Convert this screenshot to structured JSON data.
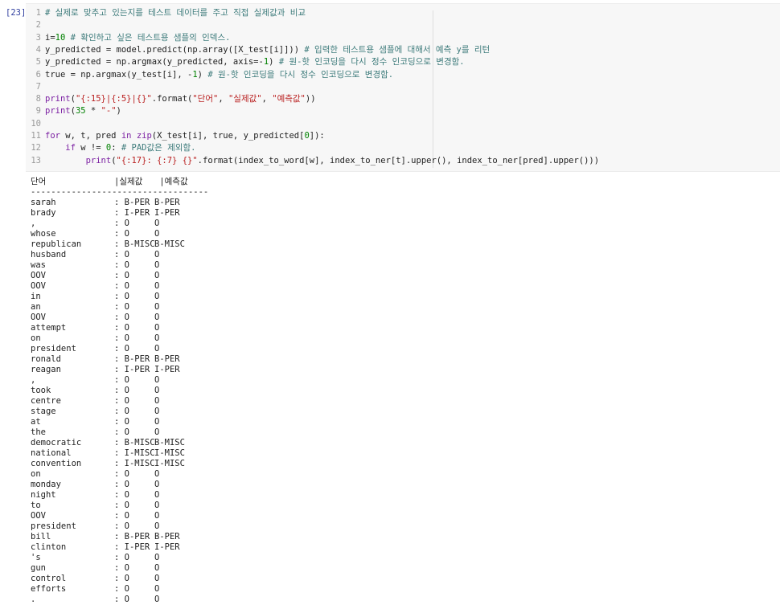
{
  "cell": {
    "prompt": "[23]",
    "code_lines": [
      {
        "n": "1",
        "segments": [
          {
            "c": "comment",
            "t": "# 실제로 맞추고 있는지를 테스트 데이터를 주고 직접 실제값과 비교"
          }
        ]
      },
      {
        "n": "2",
        "segments": []
      },
      {
        "n": "3",
        "segments": [
          {
            "c": "code-text",
            "t": "i="
          },
          {
            "c": "num",
            "t": "10"
          },
          {
            "c": "code-text",
            "t": " "
          },
          {
            "c": "comment",
            "t": "# 확인하고 싶은 테스트용 샘플의 인덱스."
          }
        ]
      },
      {
        "n": "4",
        "segments": [
          {
            "c": "code-text",
            "t": "y_predicted = model.predict(np.array([X_test[i]])) "
          },
          {
            "c": "comment",
            "t": "# 입력한 테스트용 샘플에 대해서 예측 y를 리턴"
          }
        ]
      },
      {
        "n": "5",
        "segments": [
          {
            "c": "code-text",
            "t": "y_predicted = np.argmax(y_predicted, axis=-"
          },
          {
            "c": "num",
            "t": "1"
          },
          {
            "c": "code-text",
            "t": ") "
          },
          {
            "c": "comment",
            "t": "# 원-핫 인코딩을 다시 정수 인코딩으로 변경함."
          }
        ]
      },
      {
        "n": "6",
        "segments": [
          {
            "c": "code-text",
            "t": "true = np.argmax(y_test[i], -"
          },
          {
            "c": "num",
            "t": "1"
          },
          {
            "c": "code-text",
            "t": ") "
          },
          {
            "c": "comment",
            "t": "# 원-핫 인코딩을 다시 정수 인코딩으로 변경함."
          }
        ]
      },
      {
        "n": "7",
        "segments": []
      },
      {
        "n": "8",
        "segments": [
          {
            "c": "builtin",
            "t": "print"
          },
          {
            "c": "code-text",
            "t": "("
          },
          {
            "c": "str",
            "t": "\"{:15}|{:5}|{}\""
          },
          {
            "c": "code-text",
            "t": ".format("
          },
          {
            "c": "str",
            "t": "\"단어\""
          },
          {
            "c": "code-text",
            "t": ", "
          },
          {
            "c": "str",
            "t": "\"실제값\""
          },
          {
            "c": "code-text",
            "t": ", "
          },
          {
            "c": "str",
            "t": "\"예측값\""
          },
          {
            "c": "code-text",
            "t": "))"
          }
        ]
      },
      {
        "n": "9",
        "segments": [
          {
            "c": "builtin",
            "t": "print"
          },
          {
            "c": "code-text",
            "t": "("
          },
          {
            "c": "num",
            "t": "35"
          },
          {
            "c": "code-text",
            "t": " * "
          },
          {
            "c": "str",
            "t": "\"-\""
          },
          {
            "c": "code-text",
            "t": ")"
          }
        ]
      },
      {
        "n": "10",
        "segments": []
      },
      {
        "n": "11",
        "segments": [
          {
            "c": "kw",
            "t": "for"
          },
          {
            "c": "code-text",
            "t": " w, t, pred "
          },
          {
            "c": "kw",
            "t": "in"
          },
          {
            "c": "code-text",
            "t": " "
          },
          {
            "c": "builtin",
            "t": "zip"
          },
          {
            "c": "code-text",
            "t": "(X_test[i], true, y_predicted["
          },
          {
            "c": "num",
            "t": "0"
          },
          {
            "c": "code-text",
            "t": "]):"
          }
        ]
      },
      {
        "n": "12",
        "segments": [
          {
            "c": "code-text",
            "t": "    "
          },
          {
            "c": "kw",
            "t": "if"
          },
          {
            "c": "code-text",
            "t": " w != "
          },
          {
            "c": "num",
            "t": "0"
          },
          {
            "c": "code-text",
            "t": ": "
          },
          {
            "c": "comment",
            "t": "# PAD값은 제외함."
          }
        ]
      },
      {
        "n": "13",
        "segments": [
          {
            "c": "code-text",
            "t": "        "
          },
          {
            "c": "builtin",
            "t": "print"
          },
          {
            "c": "code-text",
            "t": "("
          },
          {
            "c": "str",
            "t": "\"{:17}: {:7} {}\""
          },
          {
            "c": "code-text",
            "t": ".format(index_to_word[w], index_to_ner[t].upper(), index_to_ner[pred].upper()))"
          }
        ]
      }
    ]
  },
  "output": {
    "header": {
      "word": "단어",
      "true": "|실제값",
      "pred": " |예측값"
    },
    "separator": "-----------------------------------",
    "rows": [
      {
        "w": "sarah",
        "t": ": B-PER",
        "p": "B-PER"
      },
      {
        "w": "brady",
        "t": ": I-PER",
        "p": "I-PER"
      },
      {
        "w": ",",
        "t": ": O",
        "p": "O"
      },
      {
        "w": "whose",
        "t": ": O",
        "p": "O"
      },
      {
        "w": "republican",
        "t": ": B-MISC",
        "p": "B-MISC"
      },
      {
        "w": "husband",
        "t": ": O",
        "p": "O"
      },
      {
        "w": "was",
        "t": ": O",
        "p": "O"
      },
      {
        "w": "OOV",
        "t": ": O",
        "p": "O"
      },
      {
        "w": "OOV",
        "t": ": O",
        "p": "O"
      },
      {
        "w": "in",
        "t": ": O",
        "p": "O"
      },
      {
        "w": "an",
        "t": ": O",
        "p": "O"
      },
      {
        "w": "OOV",
        "t": ": O",
        "p": "O"
      },
      {
        "w": "attempt",
        "t": ": O",
        "p": "O"
      },
      {
        "w": "on",
        "t": ": O",
        "p": "O"
      },
      {
        "w": "president",
        "t": ": O",
        "p": "O"
      },
      {
        "w": "ronald",
        "t": ": B-PER",
        "p": "B-PER"
      },
      {
        "w": "reagan",
        "t": ": I-PER",
        "p": "I-PER"
      },
      {
        "w": ",",
        "t": ": O",
        "p": "O"
      },
      {
        "w": "took",
        "t": ": O",
        "p": "O"
      },
      {
        "w": "centre",
        "t": ": O",
        "p": "O"
      },
      {
        "w": "stage",
        "t": ": O",
        "p": "O"
      },
      {
        "w": "at",
        "t": ": O",
        "p": "O"
      },
      {
        "w": "the",
        "t": ": O",
        "p": "O"
      },
      {
        "w": "democratic",
        "t": ": B-MISC",
        "p": "B-MISC"
      },
      {
        "w": "national",
        "t": ": I-MISC",
        "p": "I-MISC"
      },
      {
        "w": "convention",
        "t": ": I-MISC",
        "p": "I-MISC"
      },
      {
        "w": "on",
        "t": ": O",
        "p": "O"
      },
      {
        "w": "monday",
        "t": ": O",
        "p": "O"
      },
      {
        "w": "night",
        "t": ": O",
        "p": "O"
      },
      {
        "w": "to",
        "t": ": O",
        "p": "O"
      },
      {
        "w": "OOV",
        "t": ": O",
        "p": "O"
      },
      {
        "w": "president",
        "t": ": O",
        "p": "O"
      },
      {
        "w": "bill",
        "t": ": B-PER",
        "p": "B-PER"
      },
      {
        "w": "clinton",
        "t": ": I-PER",
        "p": "I-PER"
      },
      {
        "w": "'s",
        "t": ": O",
        "p": "O"
      },
      {
        "w": "gun",
        "t": ": O",
        "p": "O"
      },
      {
        "w": "control",
        "t": ": O",
        "p": "O"
      },
      {
        "w": "efforts",
        "t": ": O",
        "p": "O"
      },
      {
        "w": ".",
        "t": ": O",
        "p": "O"
      }
    ]
  }
}
